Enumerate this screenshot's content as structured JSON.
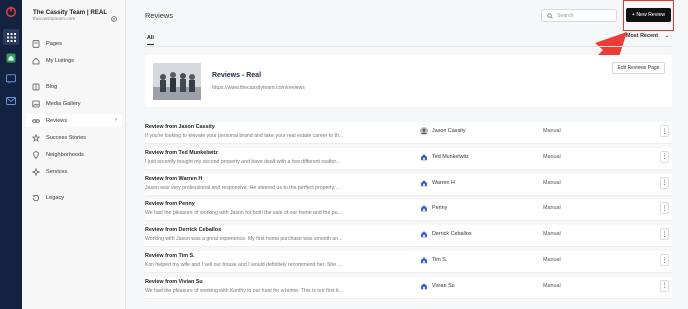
{
  "brand": {
    "name": "The Cassity Team | REAL",
    "domain": "thecassityteam.com"
  },
  "rail_icons": [
    "logo-icon",
    "grid-icon",
    "home-icon",
    "chat-icon",
    "mail-icon"
  ],
  "sidebar": {
    "items": [
      {
        "label": "Pages",
        "icon": "page-icon"
      },
      {
        "label": "My Listings",
        "icon": "house-icon"
      },
      {
        "label": "Blog",
        "icon": "blog-icon"
      },
      {
        "label": "Media Gallery",
        "icon": "image-icon"
      },
      {
        "label": "Reviews",
        "icon": "link-icon",
        "active": true
      },
      {
        "label": "Success Stories",
        "icon": "star-icon"
      },
      {
        "label": "Neighborhoods",
        "icon": "pin-icon"
      },
      {
        "label": "Services",
        "icon": "wrench-icon"
      },
      {
        "label": "Legacy",
        "icon": "history-icon"
      }
    ]
  },
  "header": {
    "title": "Reviews",
    "search_placeholder": "Search",
    "new_button": "+ New Review"
  },
  "tabs": {
    "all": "All"
  },
  "sort": {
    "label": "Most Recent"
  },
  "page_card": {
    "title": "Reviews - Real",
    "url": "https://www.thecassityteam.com/reviews",
    "edit_button": "Edit Reviews Page"
  },
  "reviews": [
    {
      "title": "Review from Jason Cassity",
      "excerpt": "If you're looking to elevate your personal brand and take your real estate career to th...",
      "author": "Jason Cassity",
      "source": "Manual",
      "avatar": "photo"
    },
    {
      "title": "Review from Ted Munkelwitz",
      "excerpt": "I just recently bought my second property and have dealt with a few different realtor...",
      "author": "Ted Munkelwitz",
      "source": "Manual",
      "avatar": "house"
    },
    {
      "title": "Review from Warren H",
      "excerpt": "Jason was very professional and responsive. He steered us to the perfect property, ...",
      "author": "Warren H",
      "source": "Manual",
      "avatar": "house"
    },
    {
      "title": "Review from Penny",
      "excerpt": "We had the pleasure of working with Jason for both the sale of our home and the pu...",
      "author": "Penny",
      "source": "Manual",
      "avatar": "house"
    },
    {
      "title": "Review from Derrick Ceballos",
      "excerpt": "Working with Jason was a great experience. My first home purchase was smooth an...",
      "author": "Derrick Ceballos",
      "source": "Manual",
      "avatar": "house"
    },
    {
      "title": "Review from Tim S.",
      "excerpt": "Kim helped my wife and I sell our house and I would definitely recommend her. She ...",
      "author": "Tim S.",
      "source": "Manual",
      "avatar": "house"
    },
    {
      "title": "Review from Vivian Su",
      "excerpt": "We had the pleasure of working with Kimthy in our hunt for a home. This is our first ti...",
      "author": "Vivian Su",
      "source": "Manual",
      "avatar": "house"
    }
  ],
  "colors": {
    "rail": "#12223f",
    "primary_button": "#111111",
    "highlight": "#e53a3a",
    "accent_blue": "#3a64c9"
  }
}
